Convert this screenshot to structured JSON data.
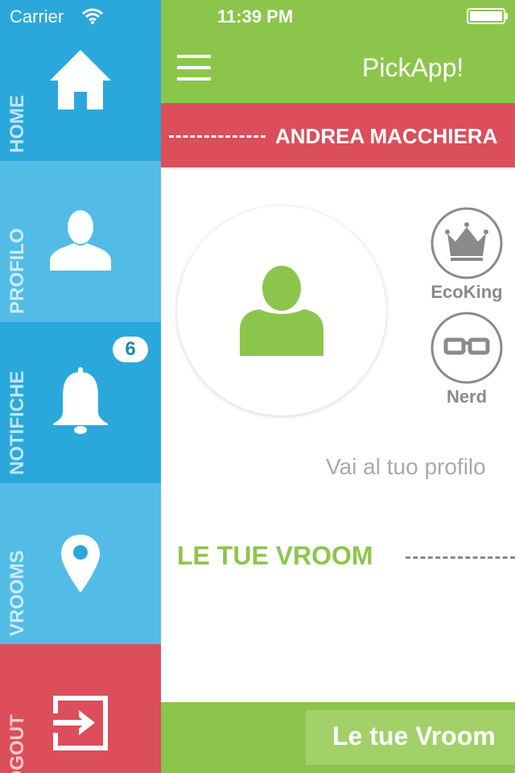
{
  "status_bar": {
    "carrier": "Carrier",
    "time": "11:39 PM"
  },
  "sidebar": {
    "items": [
      {
        "label": "HOME",
        "icon": "home-icon",
        "color": "#2aa8dc"
      },
      {
        "label": "PROFILO",
        "icon": "user-icon",
        "color": "#52bce6"
      },
      {
        "label": "NOTIFICHE",
        "icon": "bell-icon",
        "color": "#2aa8dc",
        "badge": "6"
      },
      {
        "label": "VROOMS",
        "icon": "location-pin-icon",
        "color": "#52bce6"
      },
      {
        "label": "LOGOUT",
        "icon": "logout-icon",
        "color": "#db4e5a"
      }
    ]
  },
  "header": {
    "title": "PickApp!",
    "menu_icon": "hamburger-menu-icon"
  },
  "user_banner": {
    "name": "ANDREA MACCHIERA"
  },
  "profile": {
    "avatar_icon": "user-avatar-icon",
    "link_text": "Vai al tuo profilo",
    "badges": [
      {
        "label": "EcoKing",
        "icon": "crown-icon"
      },
      {
        "label": "Nerd",
        "icon": "glasses-icon"
      }
    ]
  },
  "vroom_section": {
    "heading": "LE TUE VROOM"
  },
  "bottom_bar": {
    "button_label": "Le tue Vroom"
  },
  "colors": {
    "green": "#8cc54c",
    "red": "#db4e5a",
    "blue": "#2aa8dc",
    "light_blue": "#52bce6"
  }
}
